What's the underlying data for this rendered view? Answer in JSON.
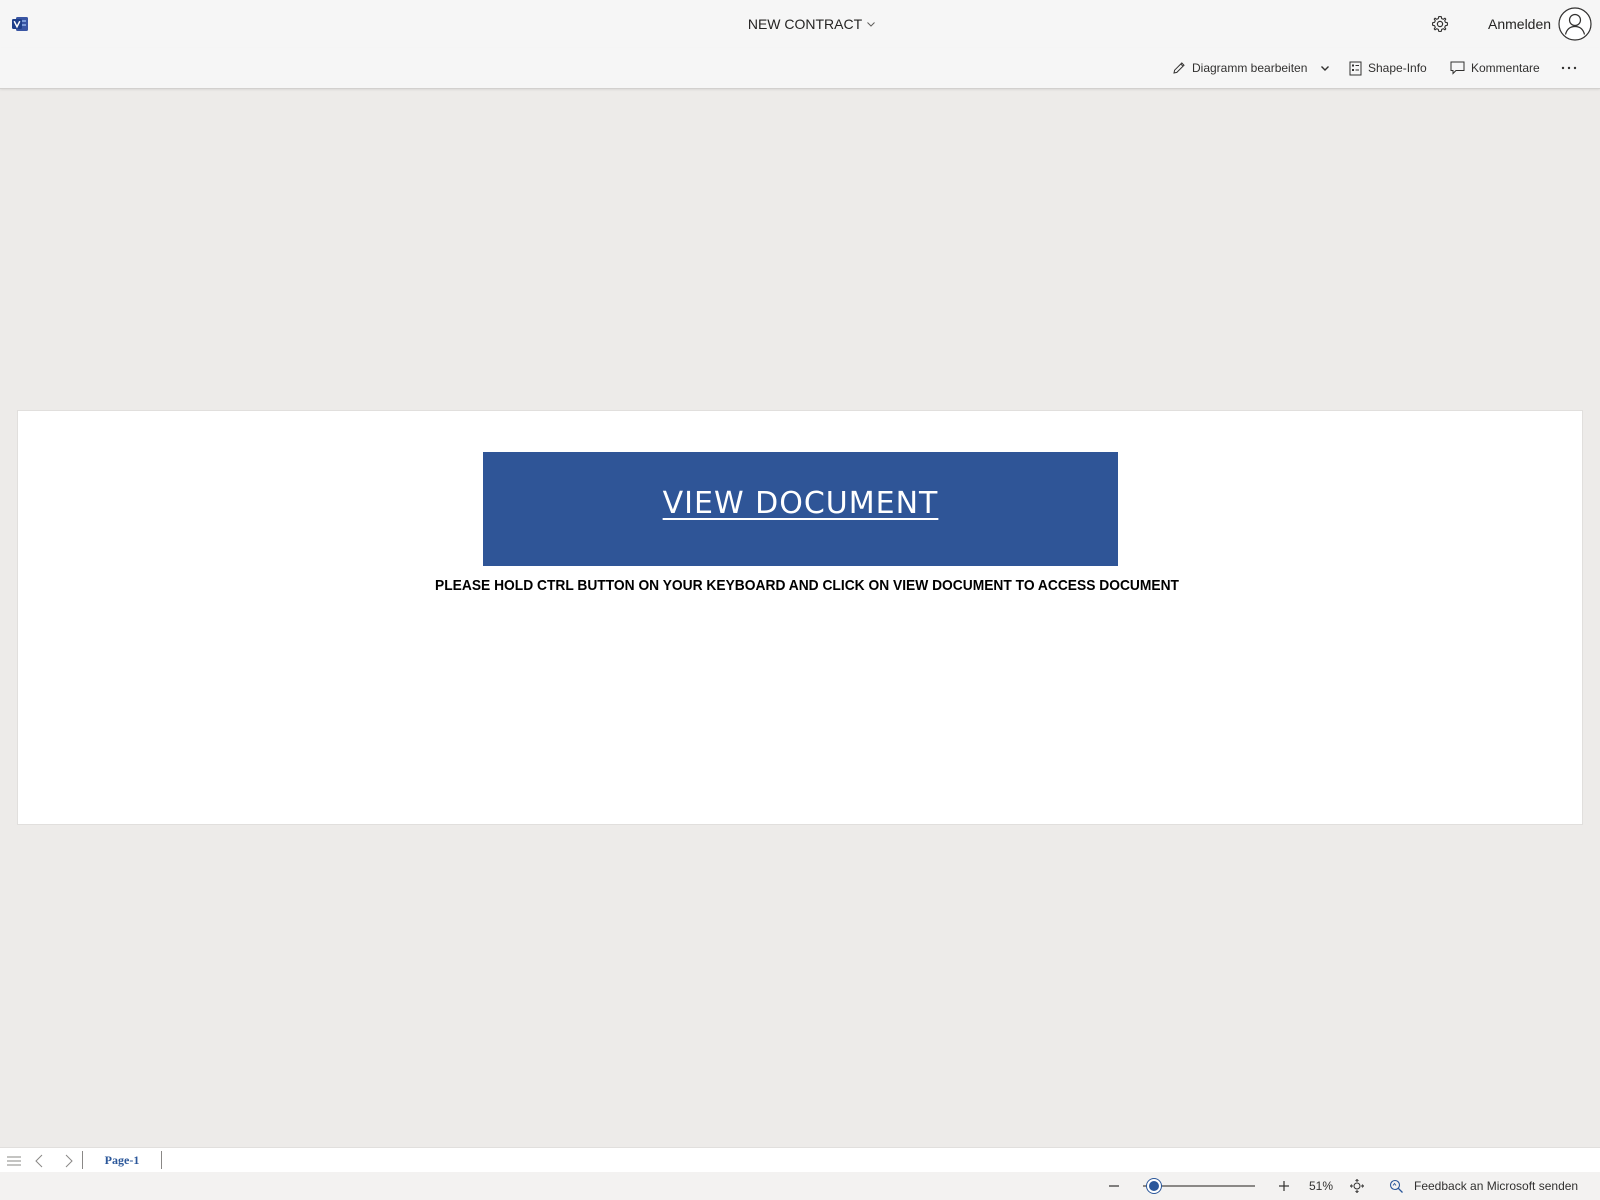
{
  "header": {
    "app_icon": "visio-app-icon",
    "document_title": "NEW CONTRACT",
    "sign_in_label": "Anmelden"
  },
  "commandbar": {
    "edit_diagram_label": "Diagramm bearbeiten",
    "shape_info_label": "Shape-Info",
    "comments_label": "Kommentare",
    "more_icon": "ellipsis-icon"
  },
  "canvas": {
    "button_label": "VIEW DOCUMENT",
    "button_color": "#2f5597",
    "instruction_text": "PLEASE HOLD CTRL BUTTON ON YOUR KEYBOARD AND CLICK ON VIEW DOCUMENT TO ACCESS DOCUMENT"
  },
  "pagebar": {
    "active_page": "Page-1"
  },
  "statusbar": {
    "zoom_label": "51%",
    "zoom_fraction": 0.1,
    "feedback_label": "Feedback an Microsoft senden"
  },
  "colors": {
    "accent": "#2b579a",
    "background": "#edebe9",
    "chrome": "#f6f6f6"
  }
}
